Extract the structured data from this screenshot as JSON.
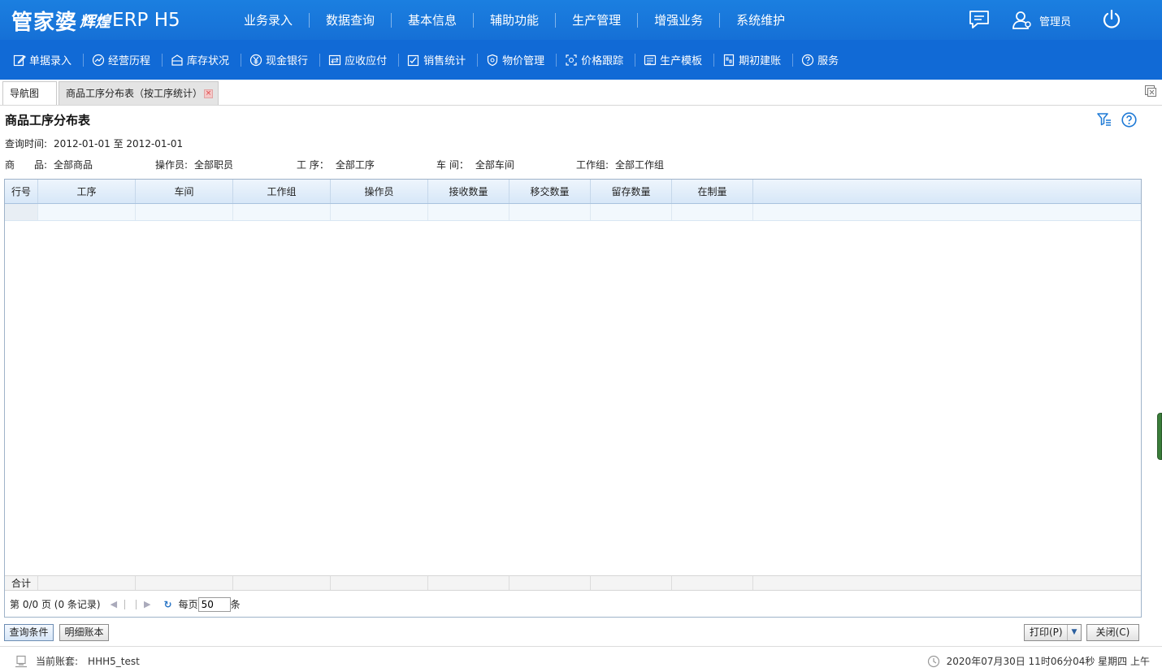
{
  "app": {
    "logo_main": "管家婆",
    "logo_sub": "辉煌",
    "logo_erp": "ERP H5",
    "top_nav": [
      "业务录入",
      "数据查询",
      "基本信息",
      "辅助功能",
      "生产管理",
      "增强业务",
      "系统维护"
    ],
    "user": "管理员"
  },
  "toolbar": [
    {
      "label": "单据录入",
      "icon": "edit-icon"
    },
    {
      "label": "经营历程",
      "icon": "chart-circle-icon"
    },
    {
      "label": "库存状况",
      "icon": "inventory-icon"
    },
    {
      "label": "现金银行",
      "icon": "yen-icon"
    },
    {
      "label": "应收应付",
      "icon": "receivable-icon"
    },
    {
      "label": "销售统计",
      "icon": "sales-check-icon"
    },
    {
      "label": "物价管理",
      "icon": "shield-price-icon"
    },
    {
      "label": "价格跟踪",
      "icon": "price-track-icon"
    },
    {
      "label": "生产模板",
      "icon": "template-icon"
    },
    {
      "label": "期初建账",
      "icon": "ledger-icon"
    },
    {
      "label": "服务",
      "icon": "help-circle-icon"
    }
  ],
  "tabs": {
    "nav": "导航图",
    "active": "商品工序分布表（按工序统计）"
  },
  "page": {
    "title": "商品工序分布表",
    "query_time_label": "查询时间:",
    "query_time_value": "2012-01-01 至 2012-01-01",
    "filters": {
      "product_label": "商　　品:",
      "product_value": "全部商品",
      "operator_label": "操作员:",
      "operator_value": "全部职员",
      "process_label": "工 序：",
      "process_value": "全部工序",
      "workshop_label": "车 间：",
      "workshop_value": "全部车间",
      "group_label": "工作组:",
      "group_value": "全部工作组"
    }
  },
  "grid": {
    "columns": [
      "行号",
      "工序",
      "车间",
      "工作组",
      "操作员",
      "接收数量",
      "移交数量",
      "留存数量",
      "在制量"
    ],
    "footer_label": "合计",
    "pager": {
      "info": "第 0/0 页 (0 条记录)",
      "per_page_label": "每页",
      "per_page_value": "50",
      "per_page_unit": "条"
    }
  },
  "buttons": {
    "query": "查询条件",
    "detail": "明细账本",
    "print": "打印(P)",
    "close": "关闭(C)"
  },
  "status": {
    "account_label": "当前账套:",
    "account_value": "HHH5_test",
    "datetime": "2020年07月30日 11时06分04秒 星期四 上午"
  }
}
